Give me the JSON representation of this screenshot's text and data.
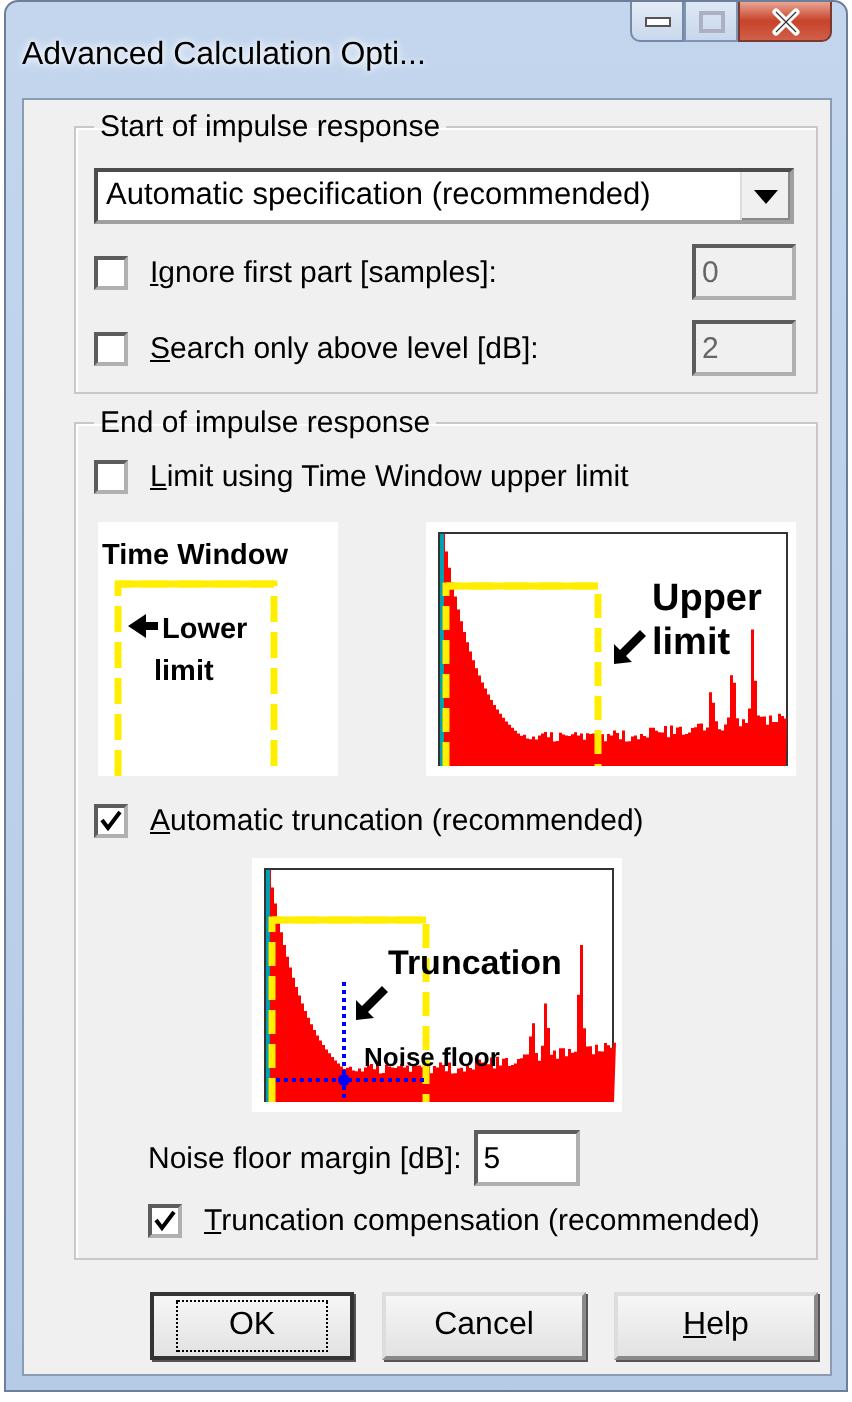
{
  "window": {
    "title": "Advanced Calculation Opti...",
    "maximize_disabled": true
  },
  "start_group": {
    "title": "Start of impulse response",
    "dropdown": {
      "value": "Automatic specification (recommended)"
    },
    "options": [
      {
        "key": "I",
        "rest": "gnore first part [samples]:",
        "checked": false,
        "value": "0",
        "disabled": true
      },
      {
        "key": "S",
        "rest": "earch only above level [dB]:",
        "checked": false,
        "value": "2",
        "disabled": true
      }
    ]
  },
  "end_group": {
    "title": "End of impulse response",
    "limit_option": {
      "key": "L",
      "rest": "imit using Time Window upper limit",
      "checked": false
    },
    "time_window_figure": {
      "title": "Time Window",
      "label": [
        "Lower",
        "limit"
      ]
    },
    "upper_limit_figure": {
      "label": [
        "Upper",
        "limit"
      ]
    },
    "auto_truncation": {
      "key": "A",
      "rest": "utomatic truncation (recommended)",
      "checked": true
    },
    "truncation_figure": {
      "label": "Truncation",
      "noise_label": "Noise floor"
    },
    "margin": {
      "label": "Noise floor margin [dB]:",
      "value": "5"
    },
    "compensation": {
      "key": "T",
      "rest": "runcation compensation (recommended)",
      "checked": true
    }
  },
  "buttons": [
    {
      "label": "OK",
      "default": true
    },
    {
      "label": "Cancel",
      "default": false
    },
    {
      "key": "H",
      "rest": "elp",
      "default": false
    }
  ]
}
